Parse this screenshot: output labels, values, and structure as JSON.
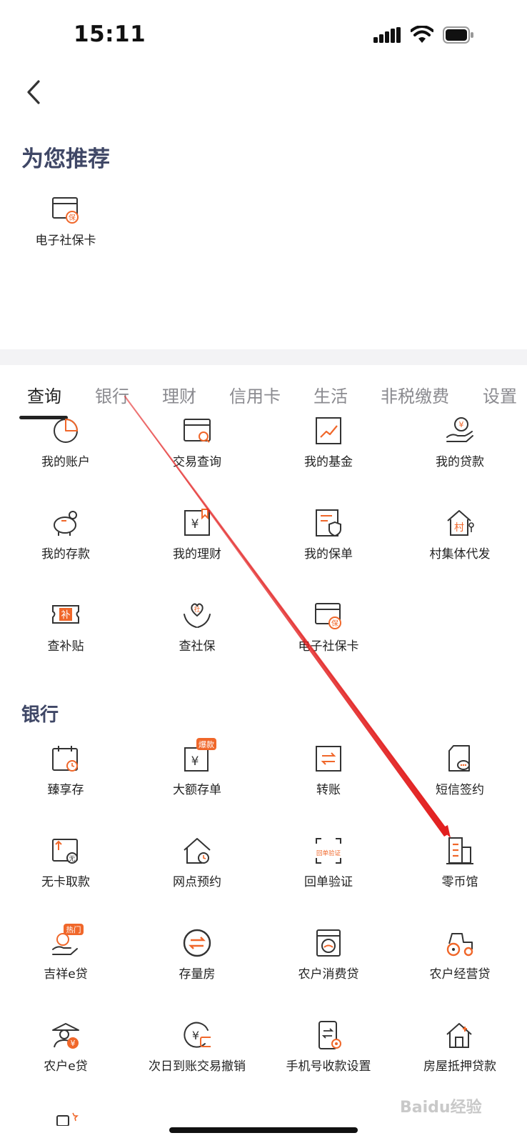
{
  "status_bar": {
    "time": "15:11"
  },
  "recommend": {
    "title": "为您推荐",
    "items": [
      {
        "label": "电子社保卡",
        "icon": "social-security-card-icon"
      }
    ]
  },
  "tabs": [
    {
      "label": "查询",
      "active": true
    },
    {
      "label": "银行",
      "active": false
    },
    {
      "label": "理财",
      "active": false
    },
    {
      "label": "信用卡",
      "active": false
    },
    {
      "label": "生活",
      "active": false
    },
    {
      "label": "非税缴费",
      "active": false
    },
    {
      "label": "设置",
      "active": false
    }
  ],
  "query_items": [
    {
      "label": "我的账户",
      "icon": "pie-chart-icon"
    },
    {
      "label": "交易查询",
      "icon": "card-search-icon"
    },
    {
      "label": "我的基金",
      "icon": "trend-chart-icon"
    },
    {
      "label": "我的贷款",
      "icon": "loan-hand-icon"
    },
    {
      "label": "我的存款",
      "icon": "piggy-bank-icon"
    },
    {
      "label": "我的理财",
      "icon": "yuan-bookmark-icon"
    },
    {
      "label": "我的保单",
      "icon": "policy-shield-icon"
    },
    {
      "label": "村集体代发",
      "icon": "village-house-icon"
    },
    {
      "label": "查补贴",
      "icon": "subsidy-ticket-icon"
    },
    {
      "label": "查社保",
      "icon": "social-insurance-hands-icon"
    },
    {
      "label": "电子社保卡",
      "icon": "social-security-card-icon"
    }
  ],
  "bank": {
    "title": "银行",
    "items": [
      {
        "label": "臻享存",
        "icon": "calendar-clock-icon"
      },
      {
        "label": "大额存单",
        "icon": "yuan-deposit-icon",
        "badge": "爆款"
      },
      {
        "label": "转账",
        "icon": "transfer-icon"
      },
      {
        "label": "短信签约",
        "icon": "sms-document-icon"
      },
      {
        "label": "无卡取款",
        "icon": "cardless-withdraw-icon",
        "badge_text": "无"
      },
      {
        "label": "网点预约",
        "icon": "branch-house-clock-icon"
      },
      {
        "label": "回单验证",
        "icon": "receipt-verify-icon",
        "badge_text": "回单验证"
      },
      {
        "label": "零币馆",
        "icon": "building-icon"
      },
      {
        "label": "吉祥e贷",
        "icon": "loan-coin-hand-icon",
        "badge": "热门"
      },
      {
        "label": "存量房",
        "icon": "exchange-circle-icon"
      },
      {
        "label": "农户消费贷",
        "icon": "washing-machine-icon"
      },
      {
        "label": "农户经营贷",
        "icon": "tractor-icon"
      },
      {
        "label": "农户e贷",
        "icon": "farmer-yuan-icon"
      },
      {
        "label": "次日到账交易撤销",
        "icon": "yuan-revoke-icon"
      },
      {
        "label": "手机号收款设置",
        "icon": "phone-transfer-icon"
      },
      {
        "label": "房屋抵押贷款",
        "icon": "house-mortgage-icon"
      }
    ]
  },
  "glyphs": {
    "card_badge": "保",
    "subsidy": "补",
    "village": "村",
    "social": "社",
    "yuan": "¥"
  },
  "watermark": "Baidu经验",
  "colors": {
    "accent": "#f0672a",
    "title": "#3f4766",
    "arrow": "#e21f1f"
  }
}
